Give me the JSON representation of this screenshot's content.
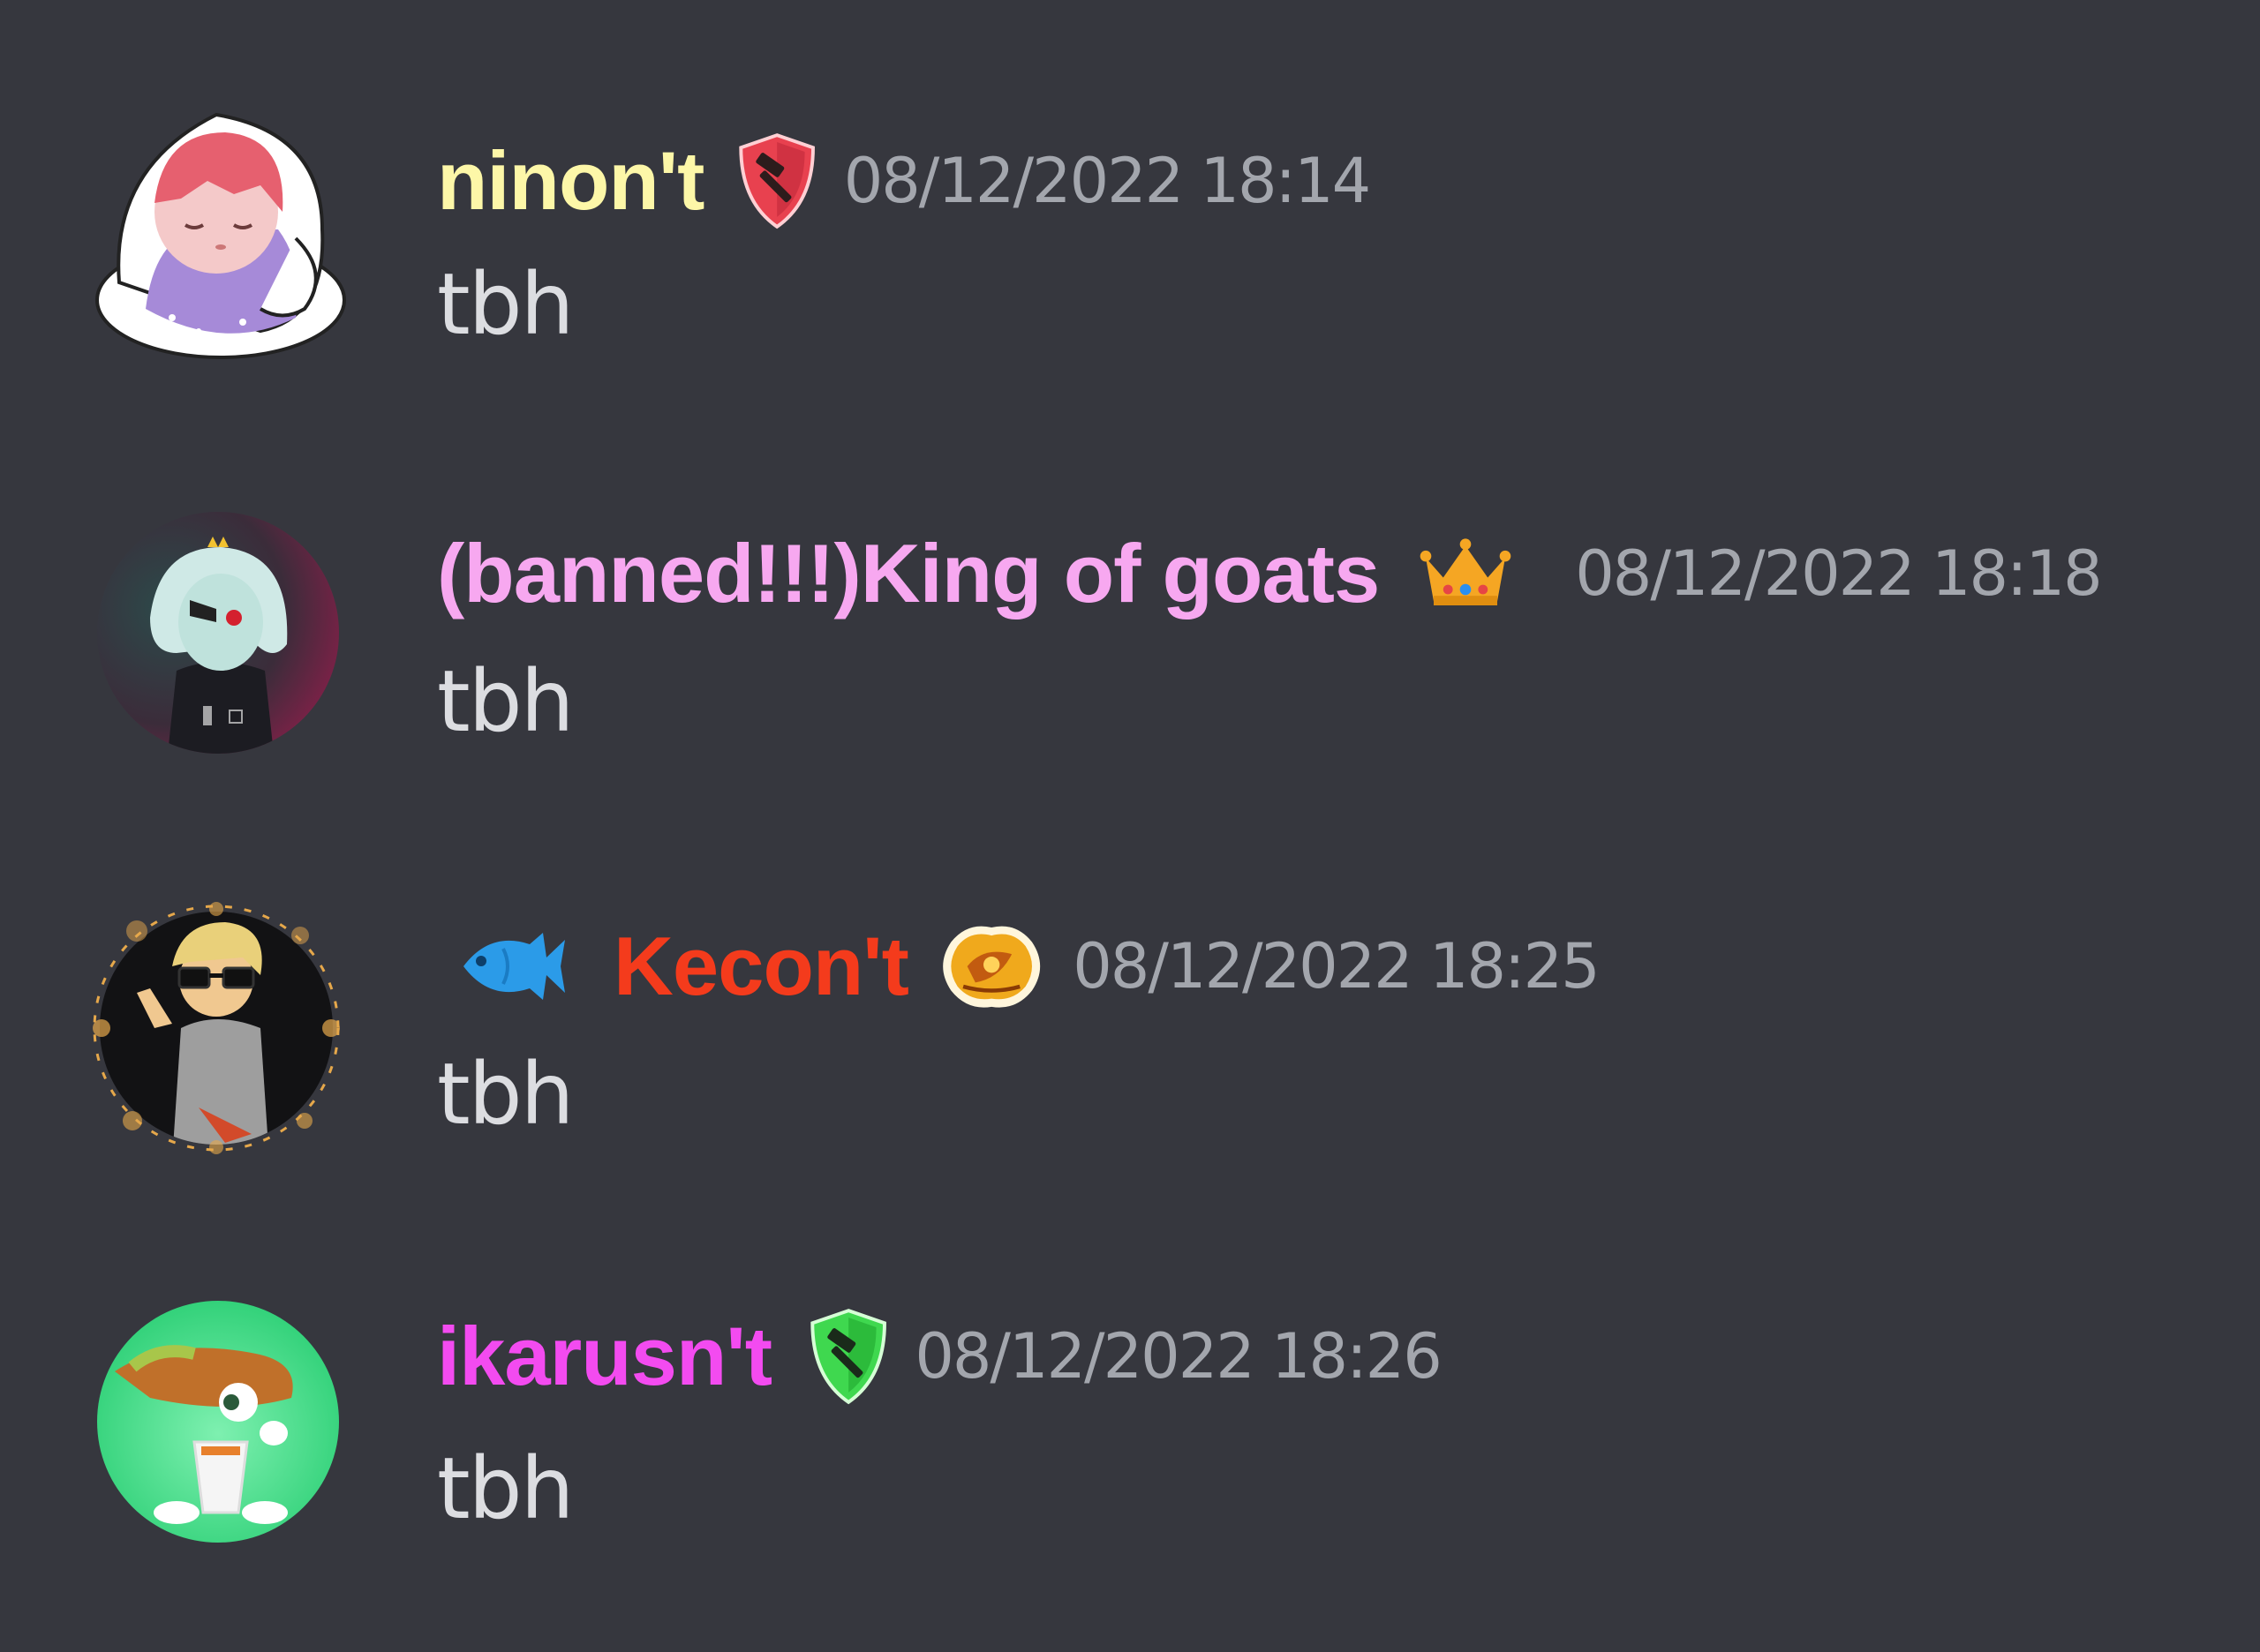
{
  "messages": [
    {
      "username": "ninon't",
      "username_color": "#fdf7a8",
      "badge": "red-shield-hammer-icon",
      "timestamp": "08/12/2022 18:14",
      "text": "tbh"
    },
    {
      "username": "(banned!!!)King of goats",
      "username_color": "#f7a8f0",
      "badge": "crown-icon",
      "timestamp": "08/12/2022 18:18",
      "text": "tbh"
    },
    {
      "prefix_icon": "fish-icon",
      "username": "Kecon't",
      "username_color": "#f43b1c",
      "badge": "gold-emblem-icon",
      "timestamp": "08/12/2022 18:25",
      "text": "tbh"
    },
    {
      "username": "ikarusn't",
      "username_color": "#f34bf0",
      "badge": "green-shield-hammer-icon",
      "timestamp": "08/12/2022 18:26",
      "text": "tbh"
    }
  ]
}
